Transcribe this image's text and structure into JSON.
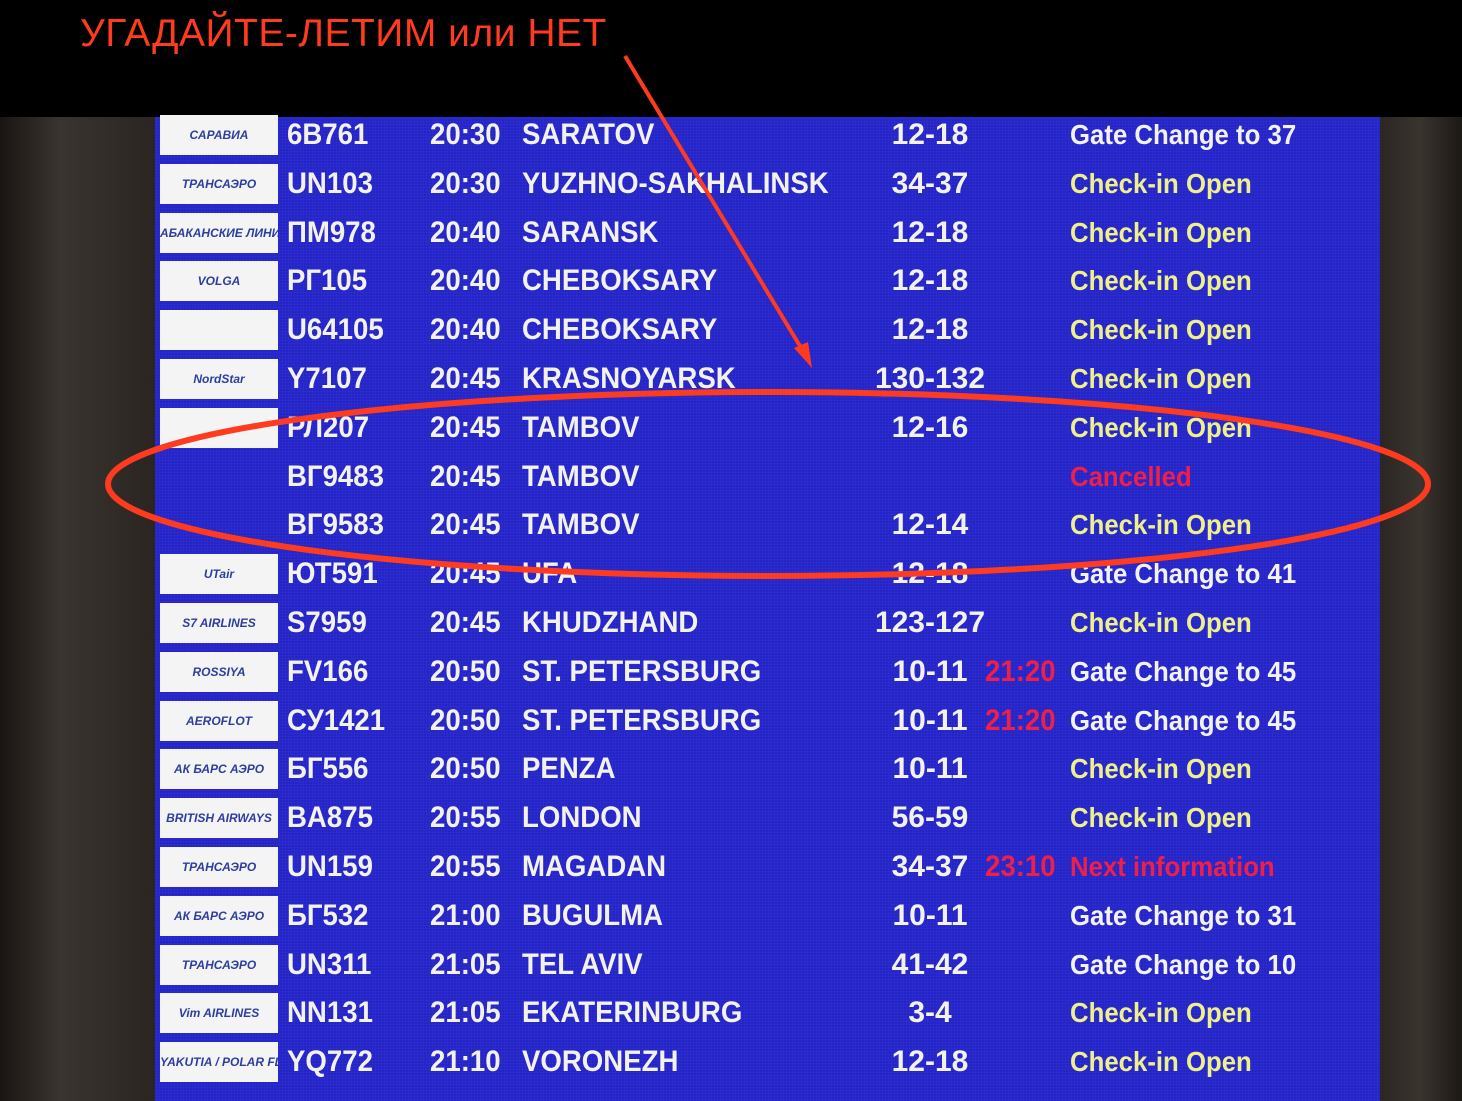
{
  "annotation": {
    "title": "УГАДАЙТЕ-ЛЕТИМ или НЕТ",
    "color": "#ff3b1f"
  },
  "colors": {
    "board": "#2424c9",
    "text": "#f2f2ea",
    "status_open": "#eef08c",
    "status_alert": "#ee1f48"
  },
  "flights": [
    {
      "logo": "САРАВИА",
      "flight": "6B761",
      "time": "20:30",
      "destination": "SARATOV",
      "gates": "12-18",
      "expected": "",
      "status": "Gate Change to 37",
      "status_type": "white"
    },
    {
      "logo": "ТРАНСАЭРО",
      "flight": "UN103",
      "time": "20:30",
      "destination": "YUZHNO-SAKHALINSK",
      "gates": "34-37",
      "expected": "",
      "status": "Check-in Open",
      "status_type": "yellow"
    },
    {
      "logo": "АБАКАНСКИЕ ЛИНИИ",
      "flight": "ПМ978",
      "time": "20:40",
      "destination": "SARANSK",
      "gates": "12-18",
      "expected": "",
      "status": "Check-in Open",
      "status_type": "yellow"
    },
    {
      "logo": "VOLGA",
      "flight": "РГ105",
      "time": "20:40",
      "destination": "CHEBOKSARY",
      "gates": "12-18",
      "expected": "",
      "status": "Check-in Open",
      "status_type": "yellow"
    },
    {
      "logo": "",
      "flight": "U64105",
      "time": "20:40",
      "destination": "CHEBOKSARY",
      "gates": "12-18",
      "expected": "",
      "status": "Check-in Open",
      "status_type": "yellow"
    },
    {
      "logo": "NordStar",
      "flight": "Y7107",
      "time": "20:45",
      "destination": "KRASNOYARSK",
      "gates": "130-132",
      "expected": "",
      "status": "Check-in Open",
      "status_type": "yellow"
    },
    {
      "logo": "",
      "flight": "РЛ207",
      "time": "20:45",
      "destination": "TAMBOV",
      "gates": "12-16",
      "expected": "",
      "status": "Check-in Open",
      "status_type": "yellow"
    },
    {
      "logo": null,
      "flight": "ВГ9483",
      "time": "20:45",
      "destination": "TAMBOV",
      "gates": "",
      "expected": "",
      "status": "Cancelled",
      "status_type": "red"
    },
    {
      "logo": null,
      "flight": "ВГ9583",
      "time": "20:45",
      "destination": "TAMBOV",
      "gates": "12-14",
      "expected": "",
      "status": "Check-in Open",
      "status_type": "yellow"
    },
    {
      "logo": "UTair",
      "flight": "ЮТ591",
      "time": "20:45",
      "destination": "UFA",
      "gates": "12-18",
      "expected": "",
      "status": "Gate Change to 41",
      "status_type": "white"
    },
    {
      "logo": "S7 AIRLINES",
      "flight": "S7959",
      "time": "20:45",
      "destination": "KHUDZHAND",
      "gates": "123-127",
      "expected": "",
      "status": "Check-in Open",
      "status_type": "yellow"
    },
    {
      "logo": "ROSSIYA",
      "flight": "FV166",
      "time": "20:50",
      "destination": "ST. PETERSBURG",
      "gates": "10-11",
      "expected": "21:20",
      "status": "Gate Change to 45",
      "status_type": "white"
    },
    {
      "logo": "AEROFLOT",
      "flight": "СУ1421",
      "time": "20:50",
      "destination": "ST. PETERSBURG",
      "gates": "10-11",
      "expected": "21:20",
      "status": "Gate Change to 45",
      "status_type": "white"
    },
    {
      "logo": "АК БАРС АЭРО",
      "flight": "БГ556",
      "time": "20:50",
      "destination": "PENZA",
      "gates": "10-11",
      "expected": "",
      "status": "Check-in Open",
      "status_type": "yellow"
    },
    {
      "logo": "BRITISH AIRWAYS",
      "flight": "BA875",
      "time": "20:55",
      "destination": "LONDON",
      "gates": "56-59",
      "expected": "",
      "status": "Check-in Open",
      "status_type": "yellow"
    },
    {
      "logo": "ТРАНСАЭРО",
      "flight": "UN159",
      "time": "20:55",
      "destination": "MAGADAN",
      "gates": "34-37",
      "expected": "23:10",
      "status": "Next information",
      "status_type": "red"
    },
    {
      "logo": "АК БАРС АЭРО",
      "flight": "БГ532",
      "time": "21:00",
      "destination": "BUGULMA",
      "gates": "10-11",
      "expected": "",
      "status": "Gate Change to 31",
      "status_type": "white"
    },
    {
      "logo": "ТРАНСАЭРО",
      "flight": "UN311",
      "time": "21:05",
      "destination": "TEL AVIV",
      "gates": "41-42",
      "expected": "",
      "status": "Gate Change to 10",
      "status_type": "white"
    },
    {
      "logo": "Vim AIRLINES",
      "flight": "NN131",
      "time": "21:05",
      "destination": "EKATERINBURG",
      "gates": "3-4",
      "expected": "",
      "status": "Check-in Open",
      "status_type": "yellow"
    },
    {
      "logo": "YAKUTIA / POLAR FLIGHT",
      "flight": "YQ772",
      "time": "21:10",
      "destination": "VORONEZH",
      "gates": "12-18",
      "expected": "",
      "status": "Check-in Open",
      "status_type": "yellow"
    }
  ]
}
